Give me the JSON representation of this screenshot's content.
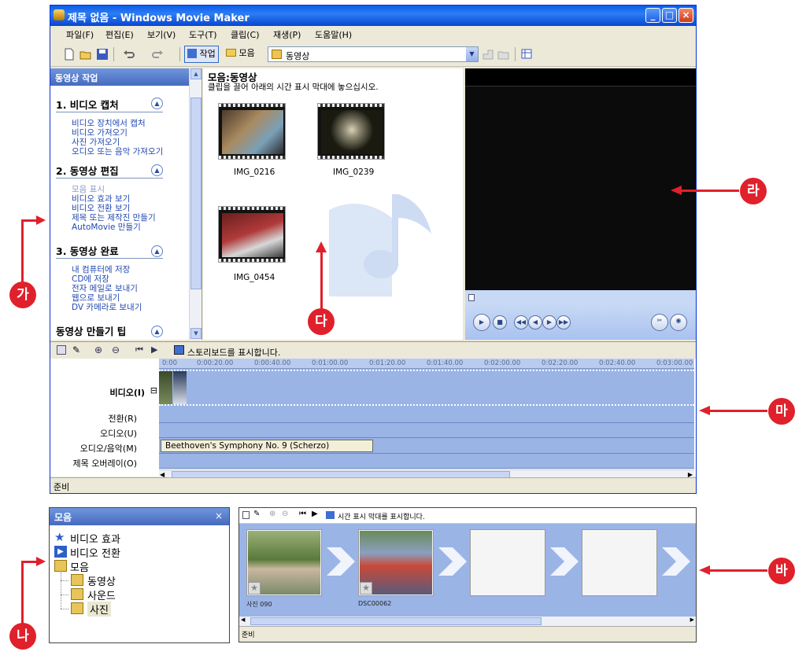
{
  "window": {
    "title": "제목 없음 - Windows Movie Maker",
    "min": "_",
    "max": "□",
    "close": "×"
  },
  "menu": [
    "파일(F)",
    "편집(E)",
    "보기(V)",
    "도구(T)",
    "클립(C)",
    "재생(P)",
    "도움말(H)"
  ],
  "toolbar": {
    "tasks_label": "작업",
    "collections_label": "모음",
    "combo_value": "동영상"
  },
  "task_pane": {
    "title": "동영상 작업",
    "close": "×",
    "sections": [
      {
        "title": "1. 비디오 캡처",
        "links": [
          "비디오 장치에서 캡처",
          "비디오 가져오기",
          "사진 가져오기",
          "오디오 또는 음악 가져오기"
        ]
      },
      {
        "title": "2. 동영상 편집",
        "links": [
          "모음 표시",
          "비디오 효과 보기",
          "비디오 전환 보기",
          "제목 또는 제작진 만들기",
          "AutoMovie 만들기"
        ]
      },
      {
        "title": "3. 동영상 완료",
        "links": [
          "내 컴퓨터에 저장",
          "CD에 저장",
          "전자 메일로 보내기",
          "웹으로 보내기",
          "DV 카메라로 보내기"
        ]
      },
      {
        "title": "동영상 만들기 팁",
        "links": []
      }
    ]
  },
  "collection": {
    "title": "모음:동영상",
    "subtitle": "클립을 끌어 아래의 시간 표시 막대에 놓으십시오.",
    "clips": [
      "IMG_0216",
      "IMG_0239",
      "IMG_0454"
    ]
  },
  "timeline": {
    "toolbar_label": "스토리보드를 표시합니다.",
    "ruler": [
      "0:00",
      "0:00:20.00",
      "0:00:40.00",
      "0:01:00.00",
      "0:01:20.00",
      "0:01:40.00",
      "0:02:00.00",
      "0:02:20.00",
      "0:02:40.00",
      "0:03:00.00"
    ],
    "tracks": {
      "video": "비디오(I)",
      "transition": "전환(R)",
      "audio": "오디오(U)",
      "audio_music": "오디오/음악(M)",
      "title_overlay": "제목 오버레이(O)"
    },
    "expand": "⊟",
    "music_clip": "Beethoven's Symphony No. 9 (Scherzo)"
  },
  "status": "준비",
  "collections_pane": {
    "title": "모음",
    "close": "×",
    "items": [
      "비디오 효과",
      "비디오 전환",
      "모음",
      "동영상",
      "사운드",
      "사진"
    ]
  },
  "storyboard": {
    "toolbar_label": "시간 표시 막대를 표시합니다.",
    "frames": [
      "사진 090",
      "DSC00062"
    ],
    "status": "준비"
  },
  "annotations": [
    "가",
    "나",
    "다",
    "라",
    "마",
    "바"
  ],
  "colors": {
    "title_blue": "#0a5ce8",
    "timeline_blue": "#9ab4e6",
    "badge_red": "#e0202b"
  }
}
